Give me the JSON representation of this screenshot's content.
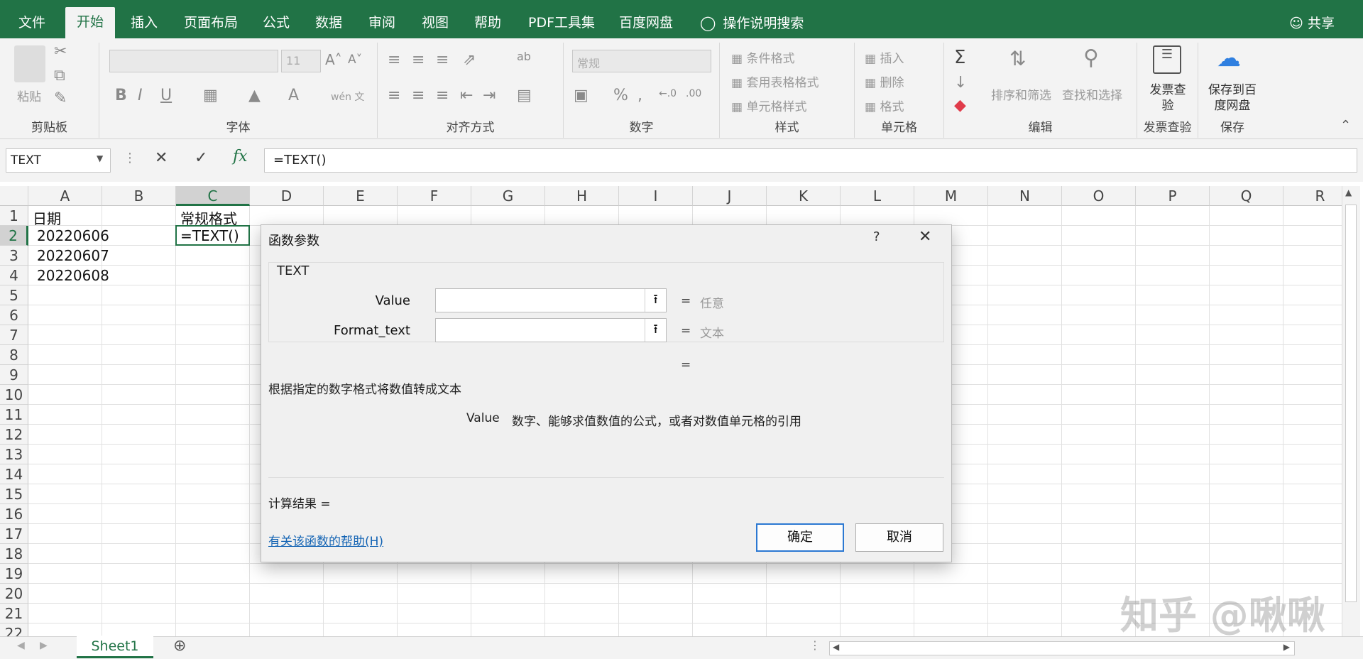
{
  "menu": {
    "tabs": [
      "文件",
      "开始",
      "插入",
      "页面布局",
      "公式",
      "数据",
      "审阅",
      "视图",
      "帮助",
      "PDF工具集",
      "百度网盘"
    ],
    "search": "操作说明搜索",
    "share": "共享"
  },
  "ribbon": {
    "clipboard": {
      "paste": "粘贴",
      "label": "剪贴板"
    },
    "font": {
      "size": "11",
      "label": "字体",
      "wen": "wén 文"
    },
    "align": {
      "label": "对齐方式"
    },
    "number": {
      "format": "常规",
      "label": "数字"
    },
    "styles": {
      "cond": "条件格式",
      "table": "套用表格格式",
      "cell": "单元格样式",
      "label": "样式"
    },
    "cells": {
      "insert": "插入",
      "delete": "删除",
      "format": "格式",
      "label": "单元格"
    },
    "edit": {
      "sort": "排序和筛选",
      "find": "查找和选择",
      "label": "编辑"
    },
    "invoice": {
      "btn": "发票查验",
      "label": "发票查验"
    },
    "save": {
      "btn": "保存到百度网盘",
      "label": "保存"
    }
  },
  "formula_bar": {
    "name_box": "TEXT",
    "formula": "=TEXT()"
  },
  "grid": {
    "columns": [
      "A",
      "B",
      "C",
      "D",
      "E",
      "F",
      "G",
      "H",
      "I",
      "J",
      "K",
      "L",
      "M",
      "N",
      "O",
      "P",
      "Q",
      "R"
    ],
    "rows": [
      "1",
      "2",
      "3",
      "4",
      "5",
      "6",
      "7",
      "8",
      "9",
      "10",
      "11",
      "12",
      "13",
      "14",
      "15",
      "16",
      "17",
      "18",
      "19",
      "20",
      "21",
      "22"
    ],
    "cells": {
      "A1": "日期",
      "A2": "20220606",
      "A3": "20220607",
      "A4": "20220608",
      "C1": "常规格式",
      "C2": "=TEXT()"
    }
  },
  "dialog": {
    "title": "函数参数",
    "help_q": "?",
    "fn_name": "TEXT",
    "args": [
      {
        "label": "Value",
        "hint": "任意"
      },
      {
        "label": "Format_text",
        "hint": "文本"
      }
    ],
    "eq": "=",
    "desc": "根据指定的数字格式将数值转成文本",
    "arg_desc_name": "Value",
    "arg_desc": "数字、能够求值数值的公式，或者对数值单元格的引用",
    "result": "计算结果 =",
    "help_link": "有关该函数的帮助(H)",
    "ok": "确定",
    "cancel": "取消"
  },
  "sheets": {
    "active": "Sheet1"
  },
  "watermark": "知乎 @啾啾"
}
